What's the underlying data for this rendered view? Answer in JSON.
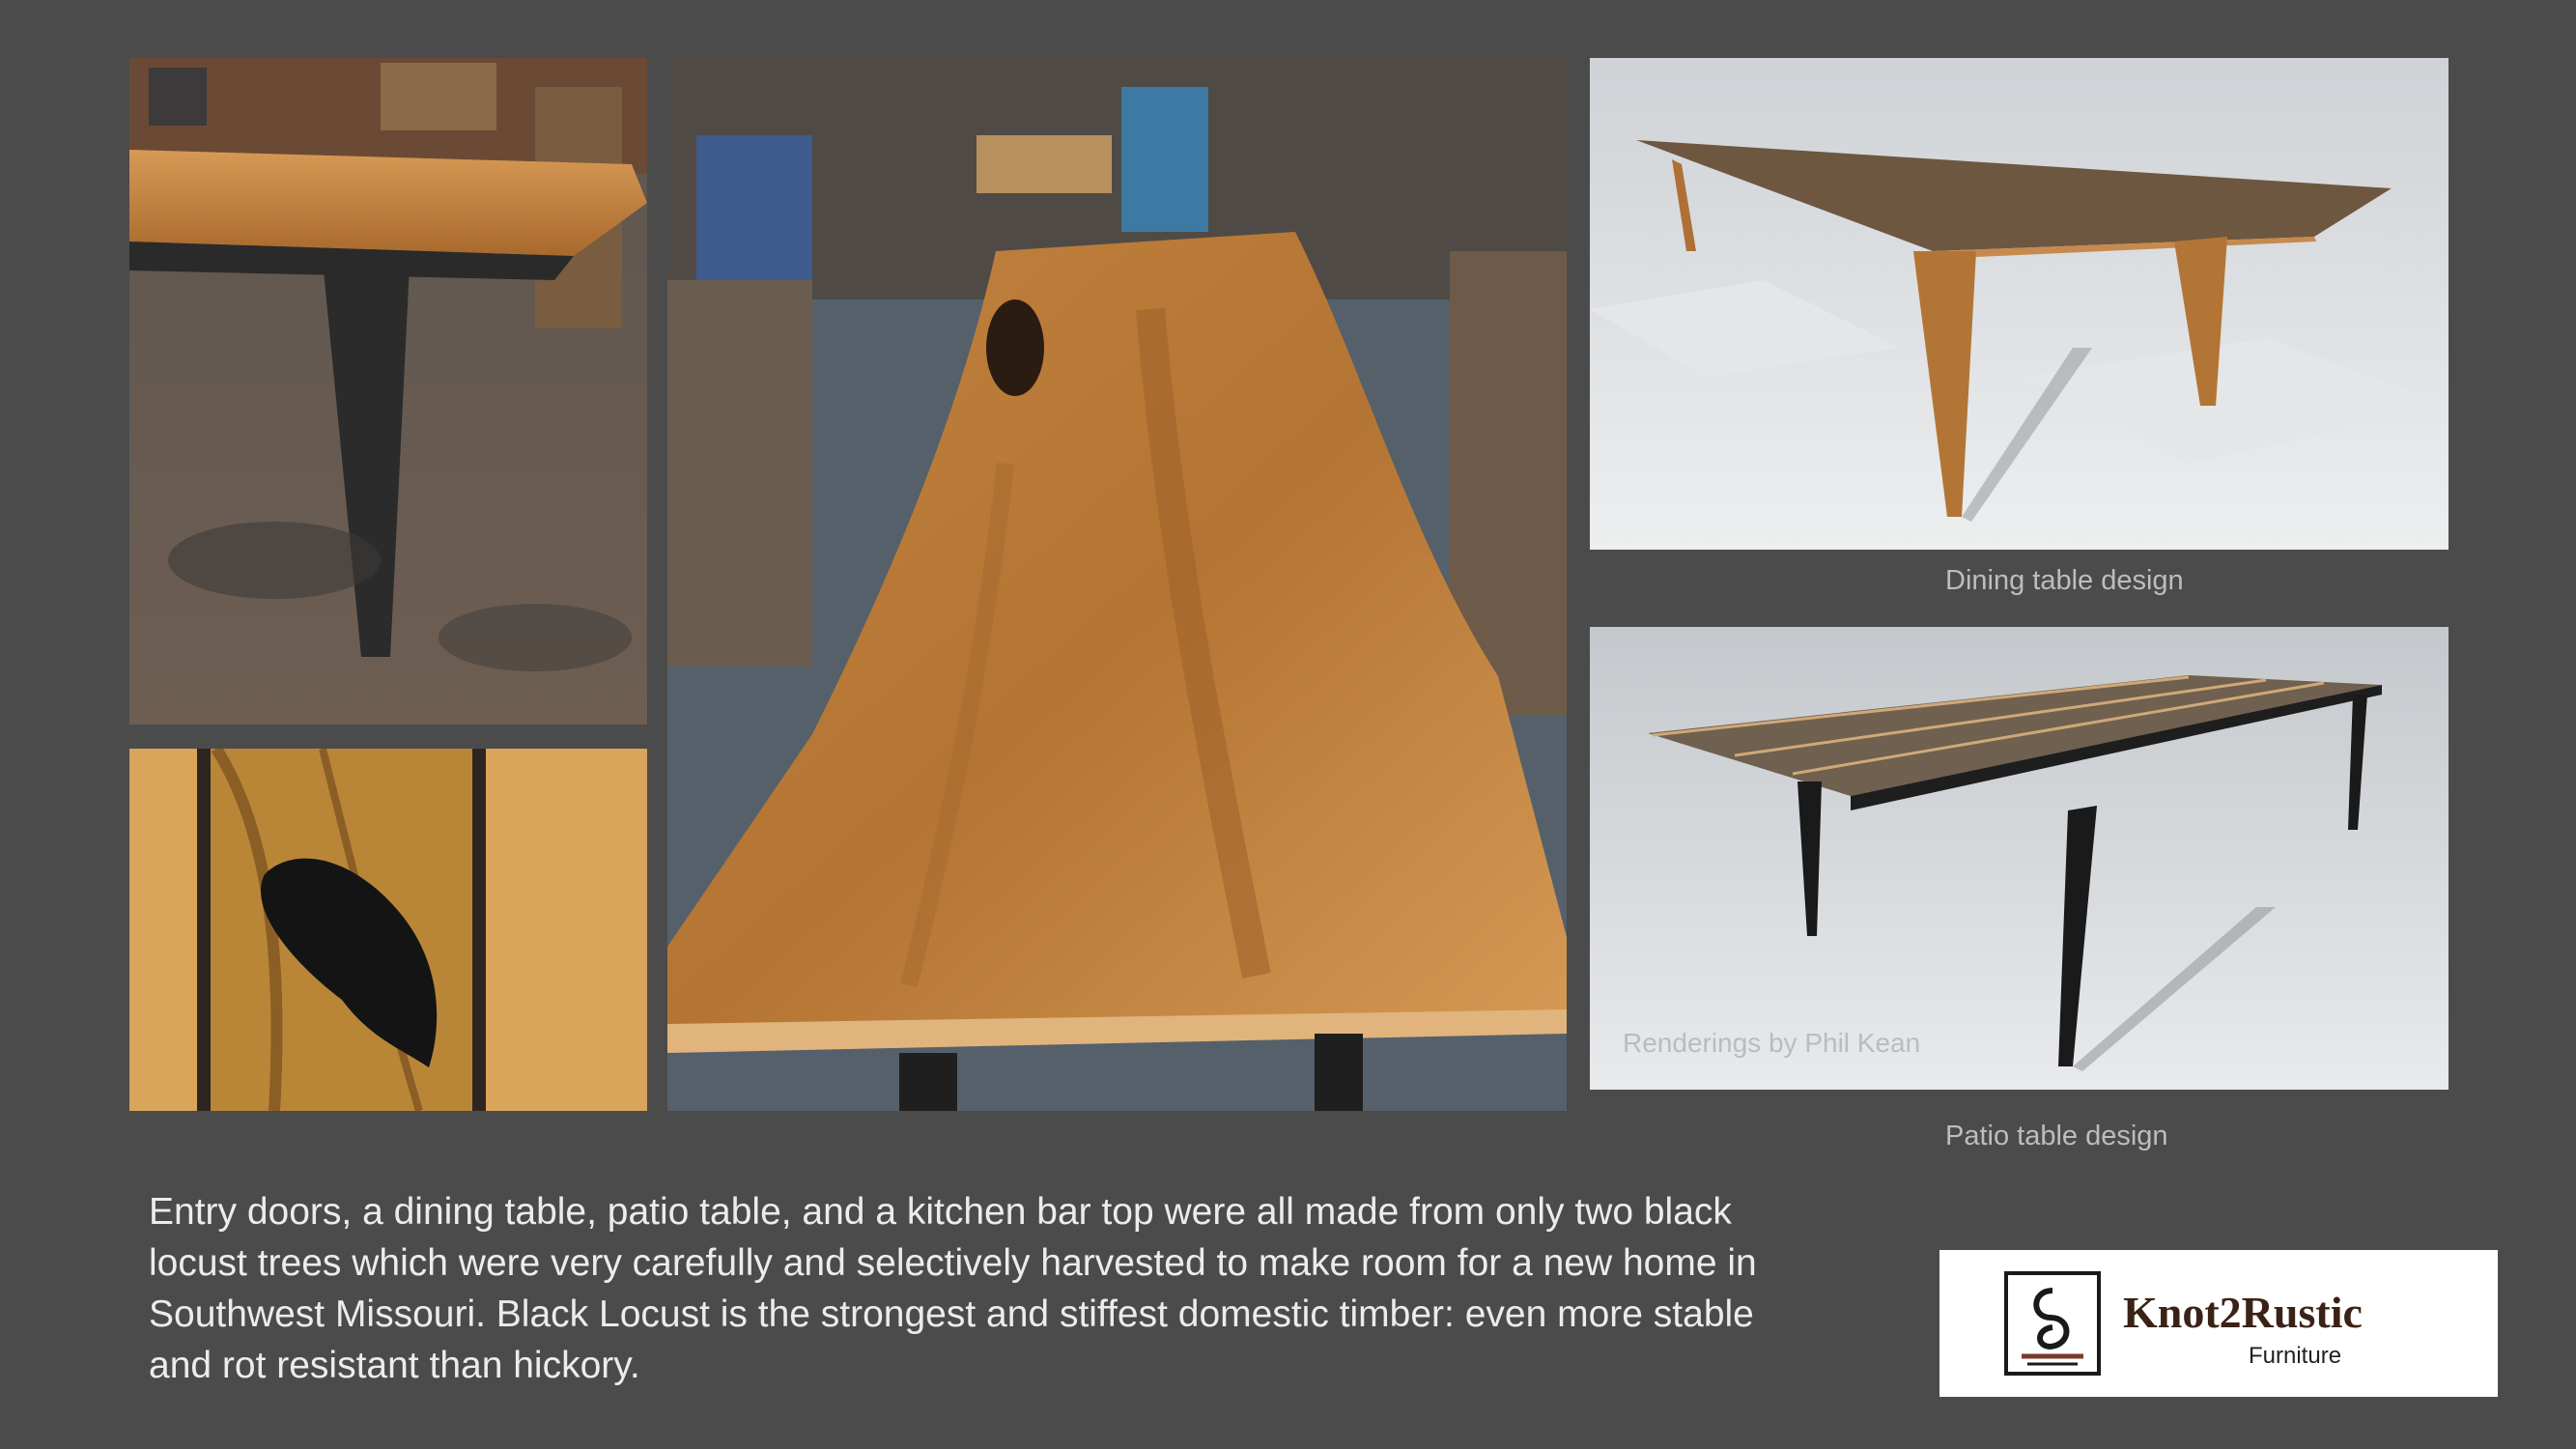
{
  "photos": {
    "table_leg": "Table leg in workshop",
    "knot": "Black epoxy filled knot",
    "slab": "Live edge black locust table top",
    "dining_render": "Dining table rendering",
    "patio_render": "Patio table rendering"
  },
  "captions": {
    "dining": "Dining table design",
    "patio": "Patio table design"
  },
  "credit": "Renderings by Phil Kean",
  "description": "Entry doors, a dining table, patio table, and a kitchen bar top were all made from only two black locust trees which were very carefully and selectively harvested to make room for a new home in Southwest Missouri.   Black Locust is the strongest and stiffest domestic timber: even more stable and rot resistant than hickory.",
  "logo": {
    "name": "Knot2Rustic",
    "subtitle": "Furniture"
  },
  "colors": {
    "background": "#4b4b4b",
    "wood": "#b07838",
    "logo_text": "#3a2216"
  }
}
